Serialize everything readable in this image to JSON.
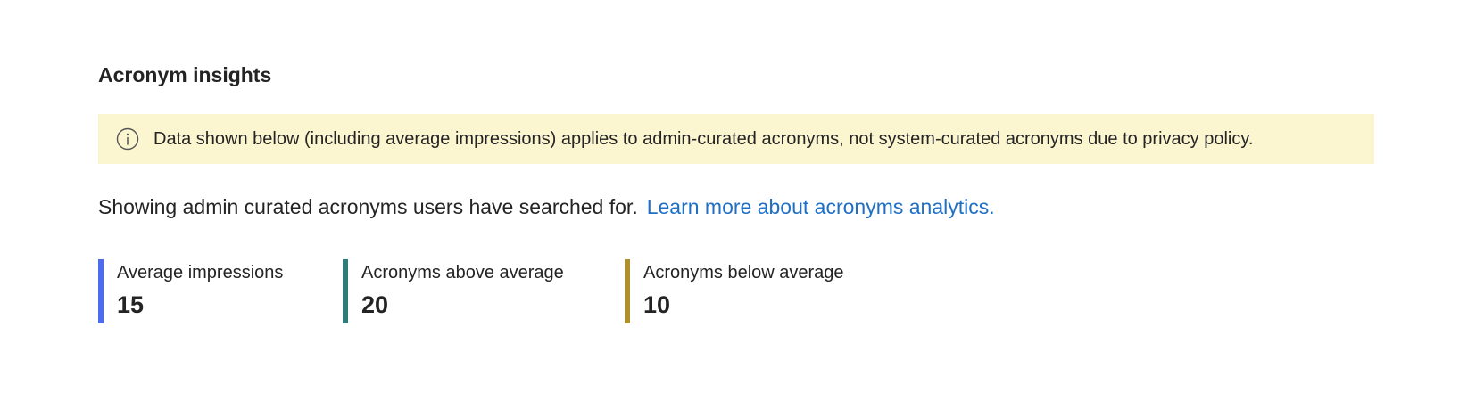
{
  "section": {
    "title": "Acronym insights"
  },
  "banner": {
    "icon": "info-icon",
    "text": "Data shown below (including average impressions) applies to admin-curated acronyms, not system-curated acronyms due to privacy policy.",
    "background": "#fbf5d0"
  },
  "intro": {
    "text": "Showing admin curated acronyms users have searched for.",
    "link_text": "Learn more about acronyms analytics.",
    "link_color": "#1f6fc4"
  },
  "metrics": [
    {
      "label": "Average impressions",
      "value": "15",
      "accent_color": "#4f6bed"
    },
    {
      "label": "Acronyms above average",
      "value": "20",
      "accent_color": "#2d7d7a"
    },
    {
      "label": "Acronyms below average",
      "value": "10",
      "accent_color": "#b08f2f"
    }
  ]
}
